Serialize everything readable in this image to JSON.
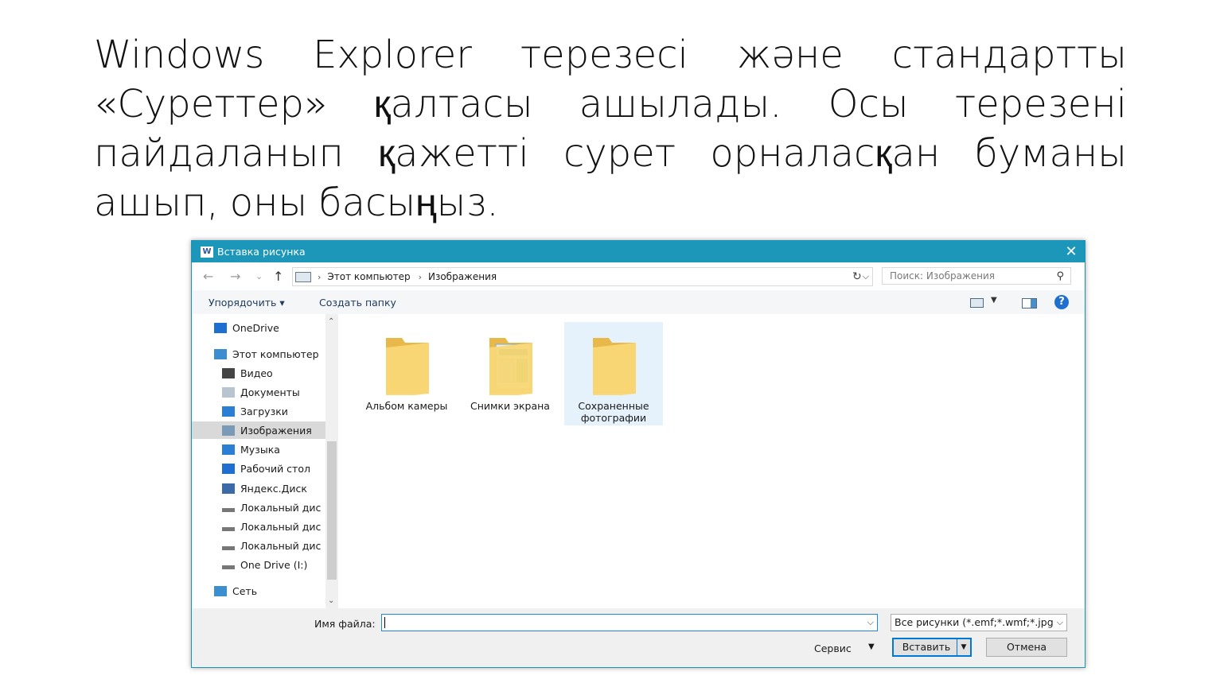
{
  "slide": {
    "lines": [
      [
        "Windows",
        "Explorer",
        "терезесі",
        "және",
        "стандартты"
      ],
      [
        "«Суреттер»",
        "қалтасы",
        "ашылады.",
        "Осы",
        "терезені"
      ],
      [
        "пайдаланып",
        "қажетті",
        "сурет",
        "орналасқан",
        "буманы"
      ],
      [
        "ашып,",
        "оны",
        "басыңыз."
      ]
    ]
  },
  "dialog": {
    "title": "Вставка рисунка",
    "app_icon_label": "W",
    "close_icon": "close-icon",
    "nav": {
      "back": "←",
      "forward": "→",
      "recent": "⌄",
      "up": "↑"
    },
    "breadcrumb": [
      "Этот компьютер",
      "Изображения"
    ],
    "search_placeholder": "Поиск: Изображения",
    "toolbar": {
      "organize": "Упорядочить ▾",
      "new_folder": "Создать папку",
      "help": "?"
    },
    "sidebar": [
      {
        "label": "OneDrive",
        "icon": "cloud-icon",
        "level": 0
      },
      {
        "label": "Этот компьютер",
        "icon": "computer-icon",
        "level": 0
      },
      {
        "label": "Видео",
        "icon": "video-icon",
        "level": 1
      },
      {
        "label": "Документы",
        "icon": "documents-icon",
        "level": 1
      },
      {
        "label": "Загрузки",
        "icon": "download-icon",
        "level": 1
      },
      {
        "label": "Изображения",
        "icon": "pictures-icon",
        "level": 1,
        "selected": true
      },
      {
        "label": "Музыка",
        "icon": "music-icon",
        "level": 1
      },
      {
        "label": "Рабочий стол",
        "icon": "desktop-icon",
        "level": 1
      },
      {
        "label": "Яндекс.Диск",
        "icon": "yandex-disk-icon",
        "level": 1
      },
      {
        "label": "Локальный дис",
        "icon": "drive-icon",
        "level": 1
      },
      {
        "label": "Локальный дис",
        "icon": "drive-icon",
        "level": 1
      },
      {
        "label": "Локальный дис",
        "icon": "drive-icon",
        "level": 1
      },
      {
        "label": "One Drive (I:)",
        "icon": "drive-icon",
        "level": 1
      },
      {
        "label": "Сеть",
        "icon": "network-icon",
        "level": 0
      }
    ],
    "folders": [
      {
        "label": "Альбом камеры",
        "icon": "folder-icon"
      },
      {
        "label": "Снимки экрана",
        "icon": "folder-screenshots-icon"
      },
      {
        "label": "Сохраненные фотографии",
        "icon": "folder-icon",
        "selected": true
      }
    ],
    "filename_label": "Имя файла:",
    "filename_value": "",
    "filetype": "Все рисунки (*.emf;*.wmf;*.jpg",
    "service": "Сервис",
    "insert": "Вставить",
    "cancel": "Отмена",
    "colors": {
      "titlebar": "#1c97ba",
      "accent": "#0078d7",
      "folder": "#f8d775",
      "selection": "#e5f1fb"
    }
  }
}
